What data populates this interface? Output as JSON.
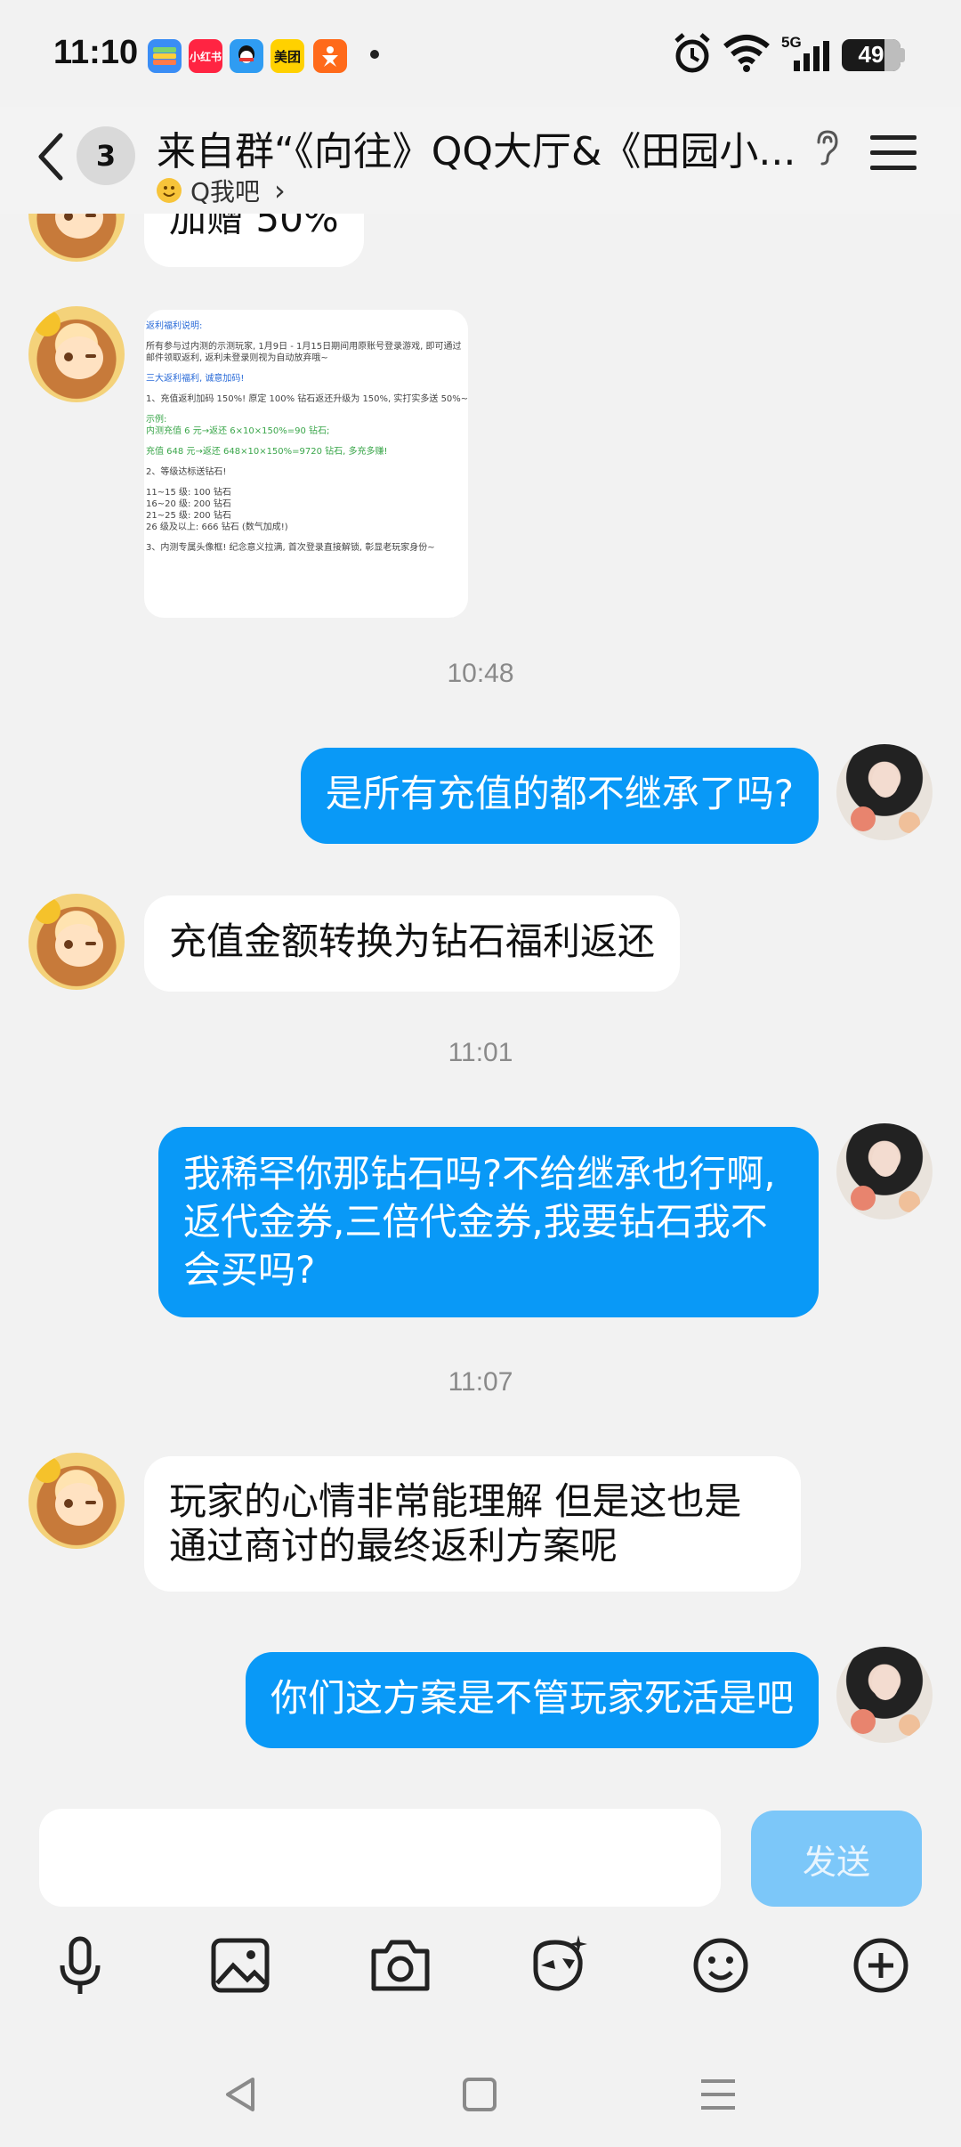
{
  "status_bar": {
    "time": "11:10",
    "apps": [
      {
        "name": "wallet-app-icon",
        "label": "",
        "color": "#3a8df5"
      },
      {
        "name": "xiaohongshu-app-icon",
        "label": "小红书",
        "color": "#ff2442"
      },
      {
        "name": "qq-app-icon",
        "label": "",
        "color": "#2f9cf2"
      },
      {
        "name": "meituan-app-icon",
        "label": "美团",
        "color": "#ffd100"
      },
      {
        "name": "taobao-app-icon",
        "label": "",
        "color": "#ff6a1a"
      }
    ],
    "network": "5G",
    "battery": "49"
  },
  "header": {
    "unread_count": "3",
    "title": "来自群“《向往》QQ大厅&《田园小...",
    "subtitle": "Q我吧",
    "subtitle_chevron": "›"
  },
  "messages": [
    {
      "side": "in",
      "type": "text",
      "text": "加赠 50%"
    },
    {
      "side": "in",
      "type": "image"
    },
    {
      "type": "time",
      "text": "10:48"
    },
    {
      "side": "out",
      "type": "text",
      "text": "是所有充值的都不继承了吗?"
    },
    {
      "side": "in",
      "type": "text",
      "text": "充值金额转换为钻石福利返还"
    },
    {
      "type": "time",
      "text": "11:01"
    },
    {
      "side": "out",
      "type": "text",
      "text": "我稀罕你那钻石吗?不给继承也行啊,返代金券,三倍代金券,我要钻石我不会买吗?"
    },
    {
      "type": "time",
      "text": "11:07"
    },
    {
      "side": "in",
      "type": "text",
      "text": "玩家的心情非常能理解 但是这也是通过商讨的最终返利方案呢"
    },
    {
      "side": "out",
      "type": "text",
      "text": "你们这方案是不管玩家死活是吧"
    }
  ],
  "image_card": {
    "lines": [
      {
        "style": "blue",
        "text": "返利福利说明:"
      },
      {
        "style": "",
        "text": "所有参与过内测的示测玩家, 1月9日 - 1月15日期间用原账号登录游戏, 即可通过"
      },
      {
        "style": "",
        "text": "邮件领取返利, 返利未登录则视为自动放弃哦~"
      },
      {
        "style": "blue",
        "text": "三大返利福利, 诚意加码!"
      },
      {
        "style": "",
        "text": "1、充值返利加码 150%! 原定 100% 钻石返还升级为 150%, 实打实多送 50%~"
      },
      {
        "style": "green",
        "text": "示例:"
      },
      {
        "style": "green",
        "text": "内测充值 6 元→返还 6×10×150%=90 钻石;"
      },
      {
        "style": "green",
        "text": "充值 648 元→返还 648×10×150%=9720 钻石, 多充多赚!"
      },
      {
        "style": "",
        "text": "2、等级达标送钻石!"
      },
      {
        "style": "",
        "text": "11~15 级: 100 钻石"
      },
      {
        "style": "",
        "text": "16~20 级: 200 钻石"
      },
      {
        "style": "",
        "text": "21~25 级: 200 钻石"
      },
      {
        "style": "",
        "text": "26 级及以上: 666 钻石 (数气加成!)"
      },
      {
        "style": "",
        "text": "3、内测专属头像框! 纪念意义拉满, 首次登录直接解锁, 彰显老玩家身份~"
      }
    ]
  },
  "input": {
    "placeholder": "",
    "send_label": "发送"
  },
  "toolbar": [
    "mic-icon",
    "gallery-icon",
    "camera-icon",
    "sticker-icon",
    "emoji-icon",
    "plus-icon"
  ],
  "colors": {
    "out_bubble": "#0999f7",
    "send_disabled": "#7cc7f9",
    "background": "#f2f2f2"
  }
}
